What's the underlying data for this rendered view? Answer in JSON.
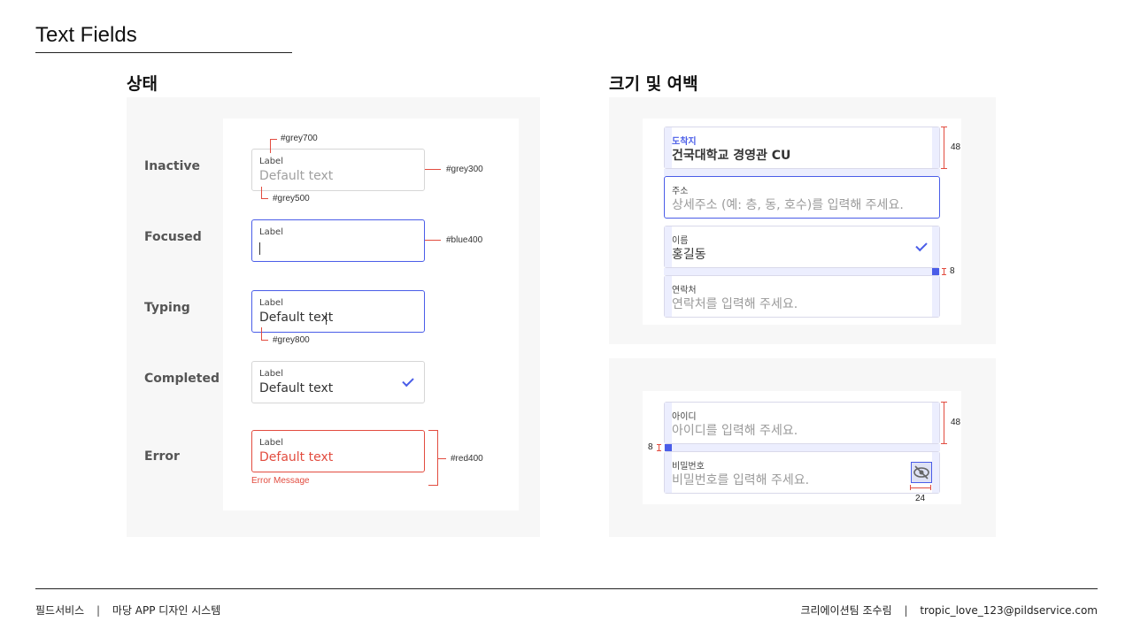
{
  "page": {
    "title": "Text Fields"
  },
  "states_section": {
    "title": "상태",
    "rows": [
      {
        "name": "Inactive",
        "label": "Label",
        "value": "Default text",
        "note_top": "#grey700",
        "note_right": "#grey300",
        "note_bottom": "#grey500"
      },
      {
        "name": "Focused",
        "label": "Label",
        "note_right": "#blue400"
      },
      {
        "name": "Typing",
        "label": "Label",
        "value": "Default text",
        "note_bottom": "#grey800"
      },
      {
        "name": "Completed",
        "label": "Label",
        "value": "Default text"
      },
      {
        "name": "Error",
        "label": "Label",
        "value": "Default text",
        "error_message": "Error Message",
        "note_right": "#red400"
      }
    ]
  },
  "size_section": {
    "title": "크기 및 여백",
    "group1": [
      {
        "label": "도착지",
        "value": "건국대학교 경영관 CU"
      },
      {
        "label": "주소",
        "placeholder": "상세주소 (예: 층, 동, 호수)를 입력해 주세요."
      },
      {
        "label": "이름",
        "value": "홍길동"
      },
      {
        "label": "연락처",
        "placeholder": "연락처를 입력해 주세요."
      }
    ],
    "group2": [
      {
        "label": "아이디",
        "placeholder": "아이디를 입력해 주세요."
      },
      {
        "label": "비밀번호",
        "placeholder": "비밀번호를 입력해 주세요."
      }
    ],
    "dims": {
      "height1": "48",
      "gap1": "8",
      "height2": "48",
      "gap2": "8",
      "icon": "24"
    }
  },
  "colors": {
    "blue": "#4a5de8",
    "red": "#e24c3f",
    "grey": "#d6d6d6"
  },
  "footer": {
    "company": "필드서비스",
    "product": "마당 APP 디자인 시스템",
    "team": "크리에이션팀 조수림",
    "email": "tropic_love_123@pildservice.com"
  }
}
